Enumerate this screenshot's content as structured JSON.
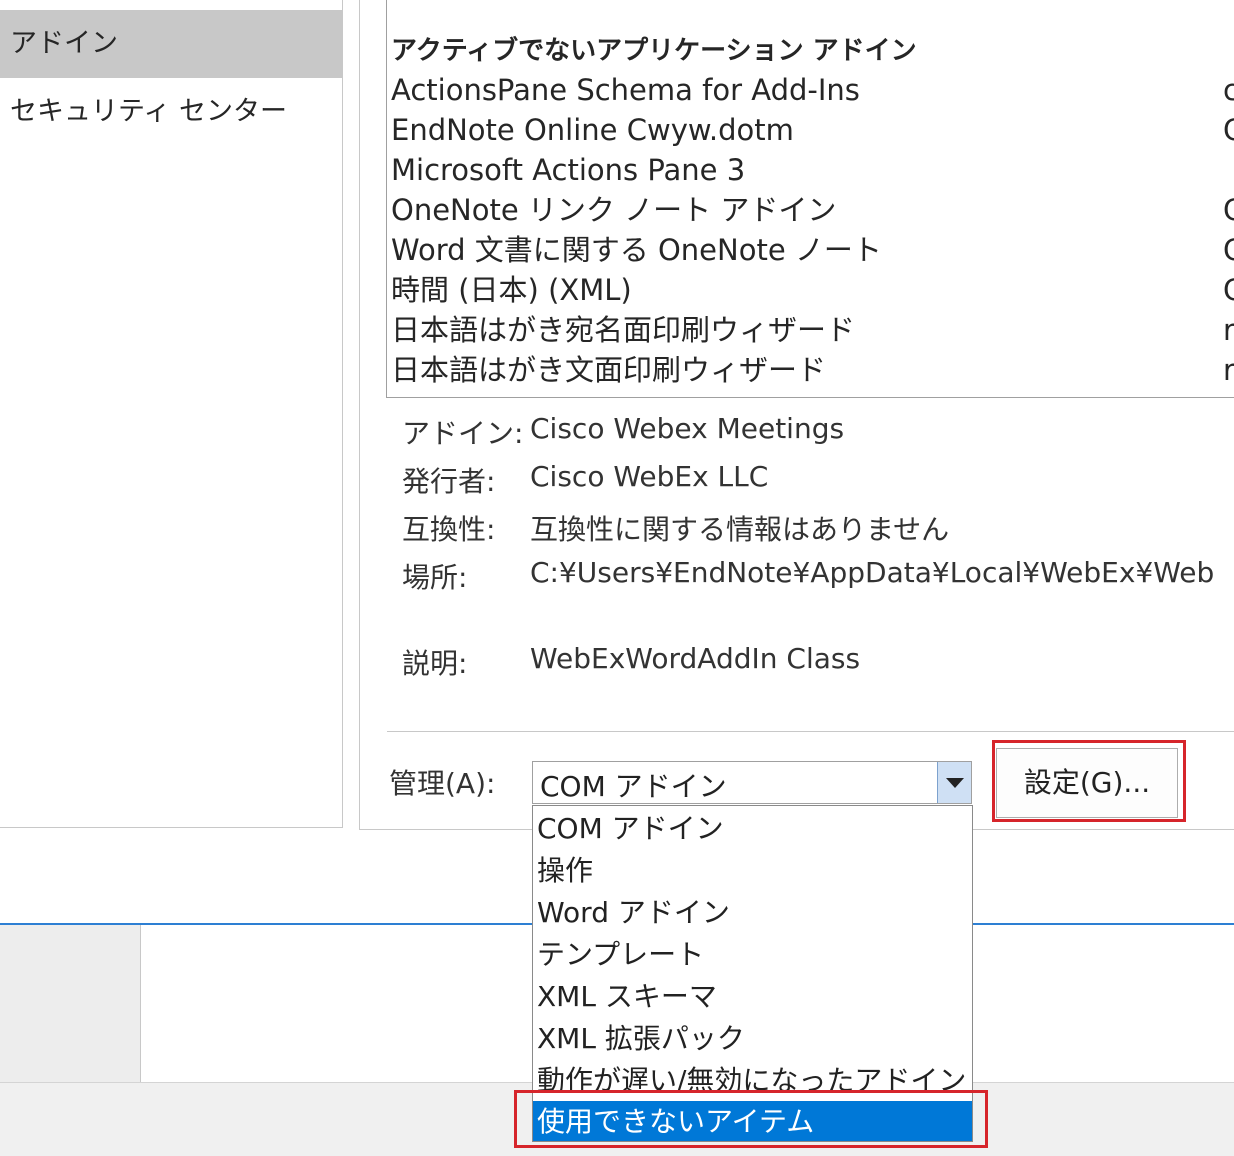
{
  "sidebar": {
    "items": [
      {
        "label": "アドイン",
        "selected": true
      },
      {
        "label": "セキュリティ センター",
        "selected": false
      }
    ]
  },
  "addin_list": {
    "group_heading": "アクティブでないアプリケーション アドイン",
    "rows": [
      {
        "name": "ActionsPane Schema for Add-Ins",
        "location": "c"
      },
      {
        "name": "EndNote Online Cwyw.dotm",
        "location": "C"
      },
      {
        "name": "Microsoft Actions Pane 3",
        "location": ""
      },
      {
        "name": "OneNote リンク ノート アドイン",
        "location": "C"
      },
      {
        "name": "Word 文書に関する OneNote ノート",
        "location": "C"
      },
      {
        "name": "時間 (日本) (XML)",
        "location": "C"
      },
      {
        "name": "日本語はがき宛名面印刷ウィザード",
        "location": "r"
      },
      {
        "name": "日本語はがき文面印刷ウィザード",
        "location": "r"
      }
    ]
  },
  "details": {
    "addin_label": "アドイン:",
    "addin_value": "Cisco Webex Meetings",
    "publisher_label": "発行者:",
    "publisher_value": "Cisco WebEx LLC",
    "compat_label": "互換性:",
    "compat_value": "互換性に関する情報はありません",
    "location_label": "場所:",
    "location_value": "C:¥Users¥EndNote¥AppData¥Local¥WebEx¥Web",
    "description_label": "説明:",
    "description_value": "WebExWordAddIn Class"
  },
  "manage": {
    "label": "管理(A):",
    "selected_value": "COM アドイン",
    "go_button": "設定(G)...",
    "options": [
      {
        "label": "COM アドイン",
        "selected": false
      },
      {
        "label": "操作",
        "selected": false
      },
      {
        "label": "Word アドイン",
        "selected": false
      },
      {
        "label": "テンプレート",
        "selected": false
      },
      {
        "label": "XML スキーマ",
        "selected": false
      },
      {
        "label": "XML 拡張パック",
        "selected": false
      },
      {
        "label": "動作が遅い/無効になったアドイン",
        "selected": false
      },
      {
        "label": "使用できないアイテム",
        "selected": true
      }
    ]
  },
  "colors": {
    "highlight_red": "#d6252b",
    "selection_blue": "#0078d7",
    "sidebar_selected": "#c8c8c8"
  }
}
